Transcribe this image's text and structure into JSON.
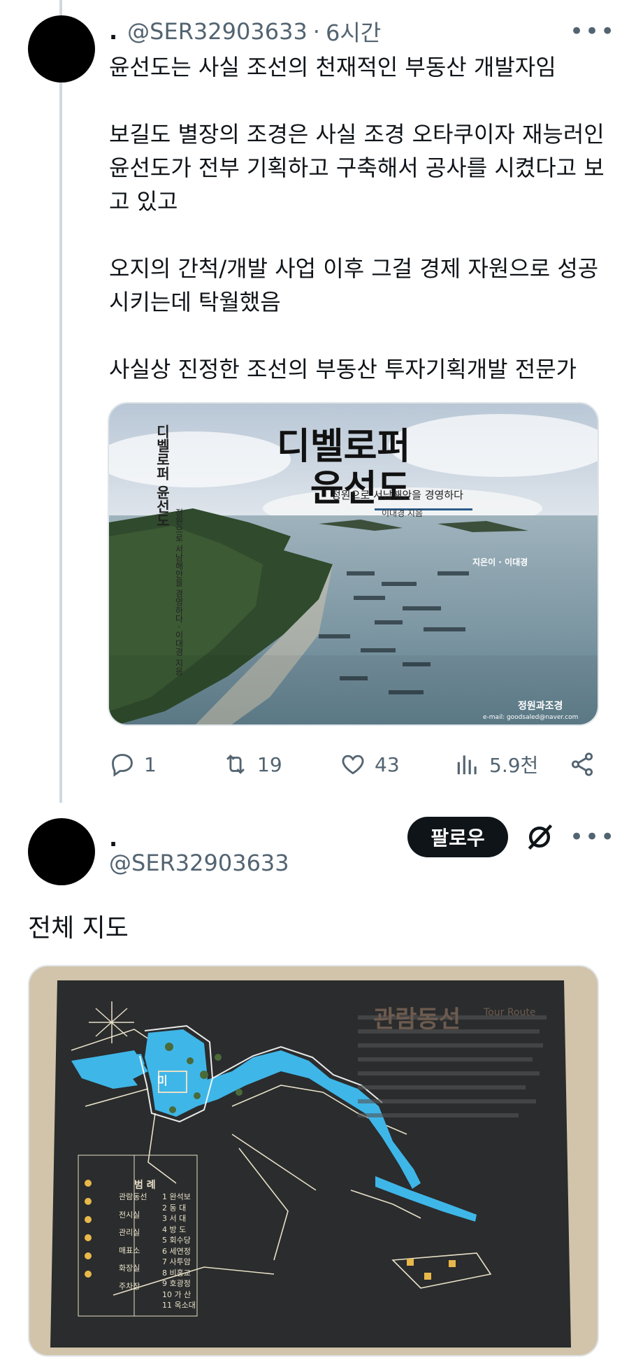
{
  "tweet1": {
    "name": ".",
    "handle": "@SER32903633",
    "separator": "·",
    "time": "6시간",
    "more_icon": "more-horizontal-icon",
    "paragraphs": [
      "윤선도는 사실 조선의 천재적인 부동산 개발자임",
      "보길도 별장의 조경은 사실 조경 오타쿠이자 재능러인 윤선도가 전부 기획하고 구축해서 공사를 시켰다고 보고 있고",
      "오지의 간척/개발 사업 이후 그걸 경제 자원으로 성공시키는데 탁월했음",
      "사실상 진정한 조선의 부동산 투자기획개발 전문가"
    ],
    "image": {
      "title_line1": "디벨로퍼",
      "title_line2": "윤선도",
      "subtitle": "정원으로 서남해안을 경영하다",
      "author": "이대경 지음",
      "spine_title": "디벨로퍼 윤선도",
      "spine_sub": "정원으로 서남해안을 경영하다 · 이대경 지음",
      "bio_label": "지은이 · 이대경",
      "publisher": "정원과조경",
      "email": "e-mail: goodsaled@naver.com"
    },
    "actions": {
      "replies": "1",
      "retweets": "19",
      "likes": "43",
      "views": "5.9천"
    }
  },
  "tweet2": {
    "name": ".",
    "handle": "@SER32903633",
    "follow_label": "팔로우",
    "text": "전체 지도",
    "map": {
      "title": "관람동선",
      "title_en": "Tour Route",
      "center_label": "미",
      "legend_title": "범 례",
      "legend_categories": [
        "관람동선",
        "전시실",
        "관리실",
        "매표소",
        "화장실",
        "주차장"
      ],
      "legend_items": [
        "1 완석보",
        "2 동 대",
        "3 서 대",
        "4 방 도",
        "5 회수당",
        "6 세연정",
        "7 사투암",
        "8 비홍교",
        "9 호광정",
        "10 가 산",
        "11 옥소대"
      ]
    }
  },
  "icons": {
    "reply": "reply-icon",
    "retweet": "retweet-icon",
    "like": "heart-icon",
    "views": "views-chart-icon",
    "share": "share-icon",
    "grok": "grok-icon"
  }
}
